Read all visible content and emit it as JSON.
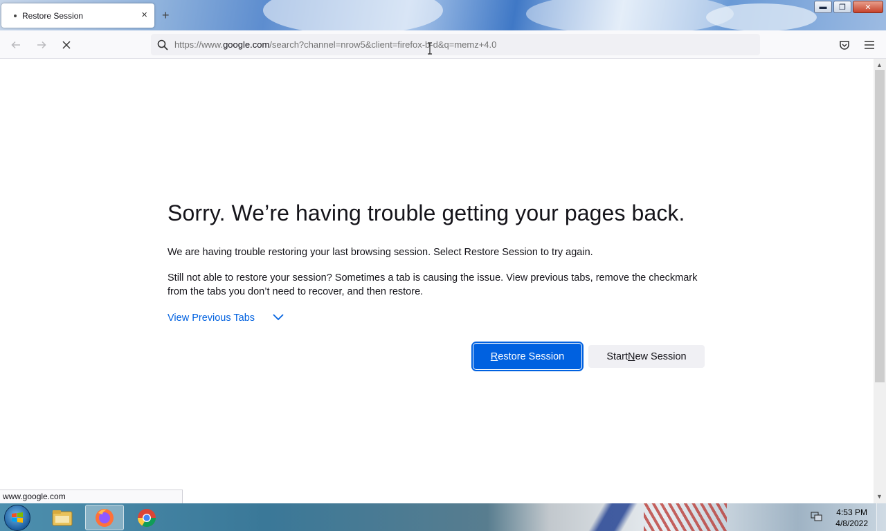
{
  "browser": {
    "tab": {
      "title": "Restore Session",
      "close_glyph": "×"
    },
    "new_tab_glyph": "+",
    "window_controls": {
      "minimize": "▬",
      "maximize": "❐",
      "close": "✕"
    },
    "url": {
      "prefix": "https://www.",
      "domain": "google.com",
      "suffix": "/search?channel=nrow5&client=firefox-b-d&q=memz+4.0"
    },
    "status_text": "www.google.com"
  },
  "page": {
    "title": "Sorry. We’re having trouble getting your pages back.",
    "paragraph1": "We are having trouble restoring your last browsing session. Select Restore Session to try again.",
    "paragraph2": "Still not able to restore your session? Sometimes a tab is causing the issue. View previous tabs, remove the checkmark from the tabs you don’t need to recover, and then restore.",
    "view_previous_tabs": "View Previous Tabs",
    "restore_button": {
      "accesskey": "R",
      "rest": "estore Session"
    },
    "new_session_button": {
      "before": "Start ",
      "accesskey": "N",
      "after": "ew Session"
    }
  },
  "taskbar": {
    "apps": [
      "file-explorer",
      "firefox",
      "chrome"
    ],
    "clock_time": "4:53 PM",
    "clock_date": "4/8/2022"
  },
  "colors": {
    "accent": "#0061e0",
    "text": "#15141a",
    "secondary_button": "#f0f0f4"
  }
}
